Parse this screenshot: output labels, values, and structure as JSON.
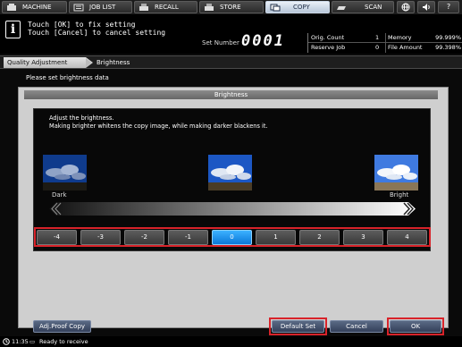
{
  "tabs": {
    "machine": "MACHINE",
    "job_list": "JOB LIST",
    "recall": "RECALL",
    "store": "STORE",
    "copy": "COPY",
    "scan": "SCAN",
    "help": "?"
  },
  "header": {
    "message_line1": "Touch [OK] to fix setting",
    "message_line2": "Touch [Cancel] to cancel setting",
    "set_number_label": "Set Number",
    "set_number_value": "0001",
    "orig_count_label": "Orig. Count",
    "orig_count_value": "1",
    "reserve_job_label": "Reserve Job",
    "reserve_job_value": "0",
    "memory_label": "Memory",
    "memory_value": "99.999%",
    "file_amount_label": "File Amount",
    "file_amount_value": "99.398%"
  },
  "breadcrumb": {
    "parent": "Quality Adjustment",
    "current": "Brightness"
  },
  "instruction": "Please set brightness data",
  "panel": {
    "title": "Brightness",
    "desc_line1": "Adjust the brightness.",
    "desc_line2": "Making brighter whitens the copy image, while making darker blackens it.",
    "dark_label": "Dark",
    "bright_label": "Bright"
  },
  "levels": {
    "items": [
      "-4",
      "-3",
      "-2",
      "-1",
      "0",
      "1",
      "2",
      "3",
      "4"
    ],
    "selected": "0"
  },
  "footer": {
    "adj_proof_copy": "Adj.Proof Copy",
    "default_set": "Default Set",
    "cancel": "Cancel",
    "ok": "OK"
  },
  "statusbar": {
    "time": "11:35",
    "status_text": "Ready to receive"
  },
  "colors": {
    "active_tab": "#c9d5e4",
    "selected_level": "#0a78d8",
    "highlight_box": "#d8232a",
    "footer_button": "#34405a"
  },
  "icons": [
    "machine-icon",
    "job-list-icon",
    "recall-icon",
    "store-icon",
    "copy-icon",
    "scan-icon",
    "globe-icon",
    "speaker-icon",
    "info-icon",
    "clock-icon"
  ]
}
